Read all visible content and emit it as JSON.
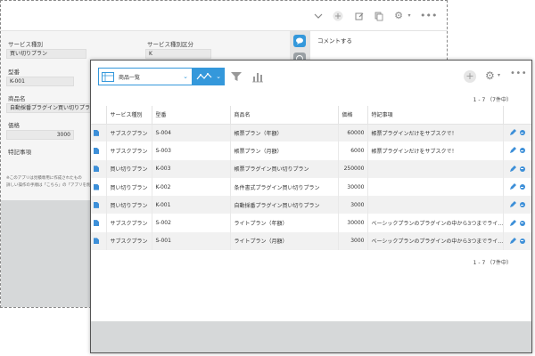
{
  "background_window": {
    "comment_title": "コメントする",
    "fields": [
      {
        "label": "サービス種別",
        "value": "買い切りプラン"
      },
      {
        "label": "サービス種別区分",
        "value": "K"
      },
      {
        "label": "型番",
        "value": "K-001"
      },
      {
        "label": "商品名",
        "value": "自動採番プラグイン買い切りプラ"
      },
      {
        "label": "価格",
        "value": "3000"
      },
      {
        "label": "特記事項",
        "value": ""
      }
    ],
    "note_line1": "※このアプリは見積専用に作成されたもの",
    "note_line2": "詳しい操作の手順は「こちら」の「アプリを削除で…"
  },
  "toolbar": {
    "view_name": "商品一覧",
    "graph_icon": "graph-line-icon",
    "filter_icon": "filter-icon",
    "chart_icon": "chart-icon",
    "more_label": "•••"
  },
  "pager": {
    "top": "1 - 7 （7件中）",
    "bottom": "1 - 7 （7件中）"
  },
  "table": {
    "headers": [
      "サービス種別",
      "型番",
      "商品名",
      "価格",
      "特記事項"
    ],
    "rows": [
      {
        "service": "サブスクプラン",
        "model": "S-004",
        "product": "帳票プラン（年額）",
        "price": "60000",
        "note": "帳票プラグインだけをサブスクで！"
      },
      {
        "service": "サブスクプラン",
        "model": "S-003",
        "product": "帳票プラン（月額）",
        "price": "6000",
        "note": "帳票プラグインだけをサブスクで！"
      },
      {
        "service": "買い切りプラン",
        "model": "K-003",
        "product": "帳票プラグイン買い切りプラン",
        "price": "250000",
        "note": ""
      },
      {
        "service": "買い切りプラン",
        "model": "K-002",
        "product": "条件書式プラグイン買い切りプラン",
        "price": "30000",
        "note": ""
      },
      {
        "service": "買い切りプラン",
        "model": "K-001",
        "product": "自動採番プラグイン買い切りプラン",
        "price": "3000",
        "note": ""
      },
      {
        "service": "サブスクプラン",
        "model": "S-002",
        "product": "ライトプラン（年額）",
        "price": "30000",
        "note": "ベーシックプランのプラグインの中から3つまでライ…"
      },
      {
        "service": "サブスクプラン",
        "model": "S-001",
        "product": "ライトプラン（月額）",
        "price": "3000",
        "note": "ベーシックプランのプラグインの中から3つまでライ…"
      }
    ]
  },
  "colors": {
    "accent": "#3498db",
    "row_alt": "#f1f1f1",
    "footer_gray": "#d6d8d9"
  }
}
